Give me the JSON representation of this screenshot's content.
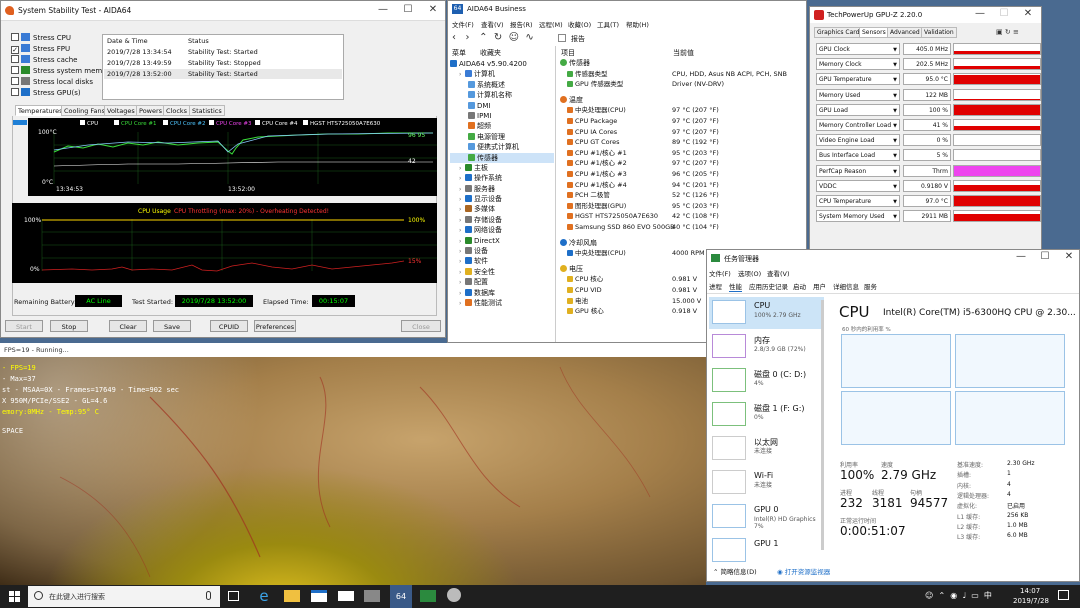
{
  "stability": {
    "title": "System Stability Test - AIDA64",
    "stress_items": [
      {
        "label": "Stress CPU",
        "checked": false
      },
      {
        "label": "Stress FPU",
        "checked": true
      },
      {
        "label": "Stress cache",
        "checked": false
      },
      {
        "label": "Stress system memory",
        "checked": false
      },
      {
        "label": "Stress local disks",
        "checked": false
      },
      {
        "label": "Stress GPU(s)",
        "checked": false
      }
    ],
    "log_headers": [
      "Date & Time",
      "Status"
    ],
    "log_rows": [
      [
        "2019/7/28 13:34:54",
        "Stability Test: Started"
      ],
      [
        "2019/7/28 13:49:59",
        "Stability Test: Stopped"
      ],
      [
        "2019/7/28 13:52:00",
        "Stability Test: Started"
      ]
    ],
    "tabs": [
      "Temperatures",
      "Cooling Fans",
      "Voltages",
      "Powers",
      "Clocks",
      "Statistics"
    ],
    "temp_legend": [
      "CPU",
      "CPU Core #1",
      "CPU Core #2",
      "CPU Core #3",
      "CPU Core #4",
      "HGST HTS725050A7E630"
    ],
    "temp_graph": {
      "y_top": "100°C",
      "y_bottom": "0°C",
      "t1": "13:34:53",
      "t2": "13:52:00",
      "val_right": "42",
      "val_top": "96 95"
    },
    "usage_graph": {
      "title": "CPU Usage",
      "throttle": "CPU Throttling (max: 20%) - Overheating Detected!",
      "y_top": "100%",
      "y_bottom": "0%",
      "r_top": "100%",
      "r_mid": "15%"
    },
    "remaining_label": "Remaining Battery:",
    "remaining_val": "AC Line",
    "started_label": "Test Started:",
    "started_val": "2019/7/28 13:52:00",
    "elapsed_label": "Elapsed Time:",
    "elapsed_val": "00:15:07",
    "buttons": [
      "Start",
      "Stop",
      "Clear",
      "Save",
      "CPUID",
      "Preferences",
      "Close"
    ]
  },
  "aida": {
    "title": "AIDA64 Business",
    "menu": [
      "文件(F)",
      "查看(V)",
      "报告(R)",
      "远程(M)",
      "收藏(O)",
      "工具(T)",
      "帮助(H)"
    ],
    "panel_tabs": [
      "菜单",
      "收藏夹"
    ],
    "report_label": "报告",
    "tree": [
      {
        "label": "AIDA64 v5.90.4200",
        "indent": 0,
        "color": "#1e6fc8"
      },
      {
        "label": "计算机",
        "indent": 1,
        "color": "#3a7bd5"
      },
      {
        "label": "系统概述",
        "indent": 2,
        "color": "#5599dd"
      },
      {
        "label": "计算机名称",
        "indent": 2,
        "color": "#5599dd"
      },
      {
        "label": "DMI",
        "indent": 2,
        "color": "#5599dd"
      },
      {
        "label": "IPMI",
        "indent": 2,
        "color": "#777777"
      },
      {
        "label": "超频",
        "indent": 2,
        "color": "#e07020"
      },
      {
        "label": "电源管理",
        "indent": 2,
        "color": "#44aa44"
      },
      {
        "label": "便携式计算机",
        "indent": 2,
        "color": "#5599dd"
      },
      {
        "label": "传感器",
        "indent": 2,
        "color": "#44aa44"
      },
      {
        "label": "主板",
        "indent": 1,
        "color": "#2a8a2a"
      },
      {
        "label": "操作系统",
        "indent": 1,
        "color": "#1e6fc8"
      },
      {
        "label": "服务器",
        "indent": 1,
        "color": "#777777"
      },
      {
        "label": "显示设备",
        "indent": 1,
        "color": "#1e6fc8"
      },
      {
        "label": "多媒体",
        "indent": 1,
        "color": "#aa6622"
      },
      {
        "label": "存储设备",
        "indent": 1,
        "color": "#777777"
      },
      {
        "label": "网络设备",
        "indent": 1,
        "color": "#1e6fc8"
      },
      {
        "label": "DirectX",
        "indent": 1,
        "color": "#2a8a2a"
      },
      {
        "label": "设备",
        "indent": 1,
        "color": "#777777"
      },
      {
        "label": "软件",
        "indent": 1,
        "color": "#1e6fc8"
      },
      {
        "label": "安全性",
        "indent": 1,
        "color": "#e0b020"
      },
      {
        "label": "配置",
        "indent": 1,
        "color": "#777777"
      },
      {
        "label": "数据库",
        "indent": 1,
        "color": "#1e6fc8"
      },
      {
        "label": "性能测试",
        "indent": 1,
        "color": "#e07020"
      }
    ],
    "col_item": "项目",
    "col_value": "当前值",
    "sections": [
      {
        "title": "传感器",
        "rows": [
          [
            "传感器类型",
            "CPU, HDD, Asus NB ACPI, PCH, SNB"
          ],
          [
            "GPU 传感器类型",
            "Driver (NV-DRV)"
          ]
        ]
      },
      {
        "title": "温度",
        "rows": [
          [
            "中央处理器(CPU)",
            "97 °C (207 °F)"
          ],
          [
            "CPU Package",
            "97 °C (207 °F)"
          ],
          [
            "CPU IA Cores",
            "97 °C (207 °F)"
          ],
          [
            "CPU GT Cores",
            "89 °C (192 °F)"
          ],
          [
            "CPU #1/核心 #1",
            "95 °C (203 °F)"
          ],
          [
            "CPU #1/核心 #2",
            "97 °C (207 °F)"
          ],
          [
            "CPU #1/核心 #3",
            "96 °C (205 °F)"
          ],
          [
            "CPU #1/核心 #4",
            "94 °C (201 °F)"
          ],
          [
            "PCH 二极管",
            "52 °C (126 °F)"
          ],
          [
            "图形处理器(GPU)",
            "95 °C (203 °F)"
          ],
          [
            "HGST HTS725050A7E630",
            "42 °C (108 °F)"
          ],
          [
            "Samsung SSD 860 EVO 500GB",
            "40 °C (104 °F)"
          ]
        ]
      },
      {
        "title": "冷却风扇",
        "rows": [
          [
            "中央处理器(CPU)",
            "4000 RPM"
          ]
        ]
      },
      {
        "title": "电压",
        "rows": [
          [
            "CPU 核心",
            "0.981 V"
          ],
          [
            "CPU VID",
            "0.981 V"
          ],
          [
            "电池",
            "15.000 V"
          ],
          [
            "GPU 核心",
            "0.918 V"
          ]
        ]
      }
    ]
  },
  "gpuz": {
    "title": "TechPowerUp GPU-Z 2.20.0",
    "tabs": [
      "Graphics Card",
      "Sensors",
      "Advanced",
      "Validation"
    ],
    "rows": [
      {
        "label": "GPU Clock",
        "value": "405.0 MHz",
        "level": 0.35,
        "color": "#e00000"
      },
      {
        "label": "Memory Clock",
        "value": "202.5 MHz",
        "level": 0.3,
        "color": "#e00000"
      },
      {
        "label": "GPU Temperature",
        "value": "95.0 °C",
        "level": 0.95,
        "color": "#e00000"
      },
      {
        "label": "Memory Used",
        "value": "122 MB",
        "level": 0.1,
        "color": "#e00000"
      },
      {
        "label": "GPU Load",
        "value": "100 %",
        "level": 1.0,
        "color": "#e00000"
      },
      {
        "label": "Memory Controller Load",
        "value": "41 %",
        "level": 0.41,
        "color": "#e00000"
      },
      {
        "label": "Video Engine Load",
        "value": "0 %",
        "level": 0.0,
        "color": "#e00000"
      },
      {
        "label": "Bus Interface Load",
        "value": "5 %",
        "level": 0.05,
        "color": "#e00000"
      },
      {
        "label": "PerfCap Reason",
        "value": "Thrm",
        "level": 1.0,
        "color": "#ee44ee"
      },
      {
        "label": "VDDC",
        "value": "0.9180 V",
        "level": 0.6,
        "color": "#e00000"
      },
      {
        "label": "CPU Temperature",
        "value": "97.0 °C",
        "level": 0.97,
        "color": "#e00000"
      },
      {
        "label": "System Memory Used",
        "value": "2911 MB",
        "level": 0.7,
        "color": "#e00000"
      }
    ]
  },
  "furmark": {
    "title": "FPS=19 - Running...",
    "lines": [
      "- FPS=19",
      "- Max=37",
      "st - MSAA=0X - Frames=17649 - Time=902 sec",
      "X 950M/PCIe/SSE2 - GL=4.6",
      "emory:0MHz - Temp:95° C",
      "SPACE"
    ]
  },
  "taskmgr": {
    "title": "任务管理器",
    "menu": [
      "文件(F)",
      "选项(O)",
      "查看(V)"
    ],
    "tabs": [
      "进程",
      "性能",
      "应用历史记录",
      "启动",
      "用户",
      "详细信息",
      "服务"
    ],
    "side": [
      {
        "name": "CPU",
        "sub": "100% 2.79 GHz"
      },
      {
        "name": "内存",
        "sub": "2.8/3.9 GB (72%)"
      },
      {
        "name": "磁盘 0 (C: D:)",
        "sub": "4%"
      },
      {
        "name": "磁盘 1 (F: G:)",
        "sub": "0%"
      },
      {
        "name": "以太网",
        "sub": "未连接"
      },
      {
        "name": "Wi-Fi",
        "sub": "未连接"
      },
      {
        "name": "GPU 0",
        "sub": "Intel(R) HD Graphics 7%"
      },
      {
        "name": "GPU 1",
        "sub": ""
      }
    ],
    "cpu_title": "CPU",
    "cpu_name": "Intel(R) Core(TM) i5-6300HQ CPU @ 2.30...",
    "graph_caption": "60 秒内的利用率 %",
    "graph_caption_bottom": "60 秒内的利用率 %",
    "stats": {
      "util_label": "利用率",
      "util_val": "100%",
      "speed_label": "速度",
      "speed_val": "2.79 GHz",
      "proc_label": "进程",
      "proc_val": "232",
      "thread_label": "线程",
      "thread_val": "3181",
      "handle_label": "句柄",
      "handle_val": "94577",
      "uptime_label": "正常运行时间",
      "uptime_val": "0:00:51:07"
    },
    "specs": [
      [
        "基准速度:",
        "2.30 GHz"
      ],
      [
        "插槽:",
        "1"
      ],
      [
        "内核:",
        "4"
      ],
      [
        "逻辑处理器:",
        "4"
      ],
      [
        "虚拟化:",
        "已启用"
      ],
      [
        "L1 缓存:",
        "256 KB"
      ],
      [
        "L2 缓存:",
        "1.0 MB"
      ],
      [
        "L3 缓存:",
        "6.0 MB"
      ]
    ],
    "fewer": "简略信息(D)",
    "monitor": "打开资源监视器"
  },
  "taskbar": {
    "search": "在此键入进行搜索",
    "time": "14:07",
    "date": "2019/7/28"
  }
}
